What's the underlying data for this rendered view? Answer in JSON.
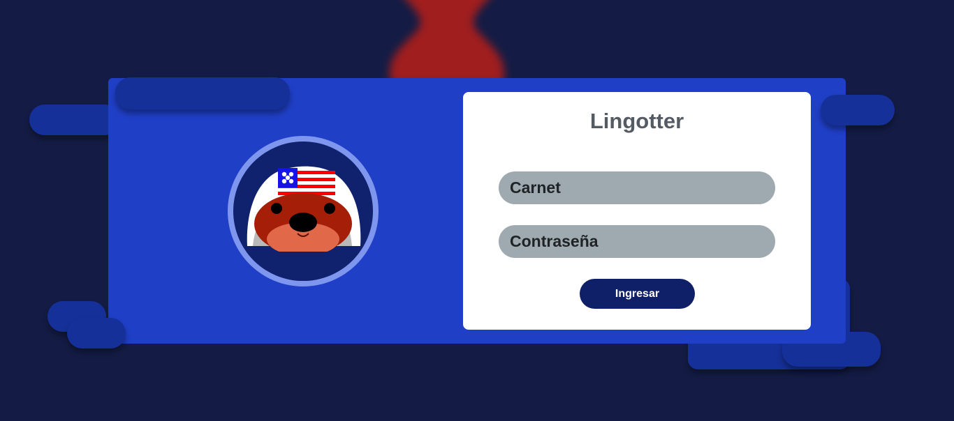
{
  "app": {
    "title": "Lingotter"
  },
  "login": {
    "username_placeholder": "Carnet",
    "password_placeholder": "Contraseña",
    "submit_label": "Ingresar"
  },
  "colors": {
    "background": "#141c45",
    "card": "#1f3fc6",
    "decor_blob": "#16309a",
    "panel": "#ffffff",
    "input": "#9ea9b0",
    "button": "#0f2068",
    "accent_red": "#a01e1e"
  },
  "icons": {
    "logo": "otter-mascot-icon"
  }
}
